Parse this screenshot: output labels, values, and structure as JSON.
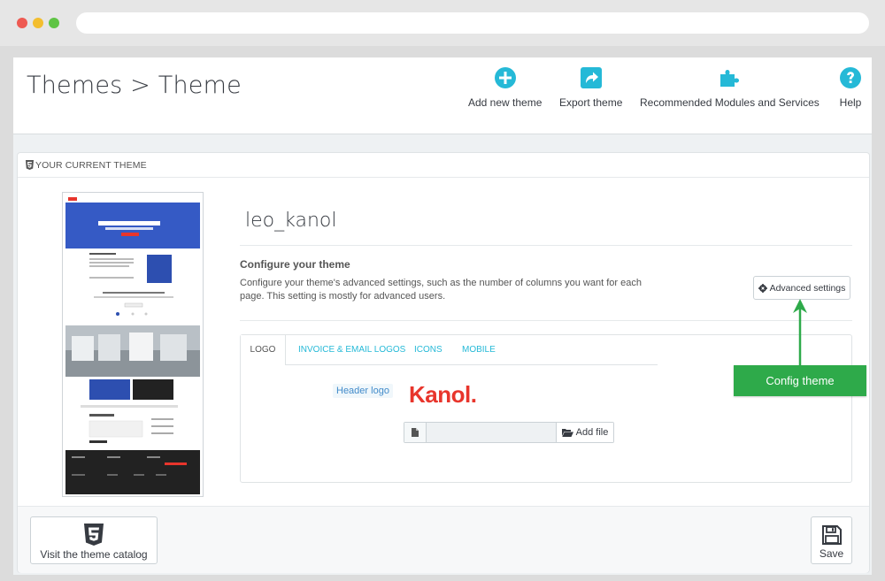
{
  "header": {
    "title": "Themes > Theme",
    "toolbar": [
      {
        "label": "Add new theme",
        "icon": "plus-circle-icon"
      },
      {
        "label": "Export theme",
        "icon": "share-icon"
      },
      {
        "label": "Recommended Modules and Services",
        "icon": "puzzle-icon"
      },
      {
        "label": "Help",
        "icon": "question-circle-icon"
      }
    ]
  },
  "panel": {
    "heading": "YOUR CURRENT THEME",
    "theme_name": "leo_kanol",
    "config_title": "Configure your theme",
    "config_desc": "Configure your theme's advanced settings, such as the number of columns you want for each page. This setting is mostly for advanced users.",
    "advanced_button": "Advanced settings",
    "tabs": [
      "LOGO",
      "INVOICE & EMAIL LOGOS",
      "ICONS",
      "MOBILE"
    ],
    "header_logo_label": "Header logo",
    "logo_text": "Kanol",
    "logo_dot": ".",
    "add_file": "Add file",
    "visit_catalog": "Visit the theme catalog",
    "save": "Save"
  },
  "callout": {
    "label": "Config theme"
  },
  "colors": {
    "accent": "#25b9d7",
    "callout": "#2eaa4a",
    "logo": "#e8352c"
  }
}
